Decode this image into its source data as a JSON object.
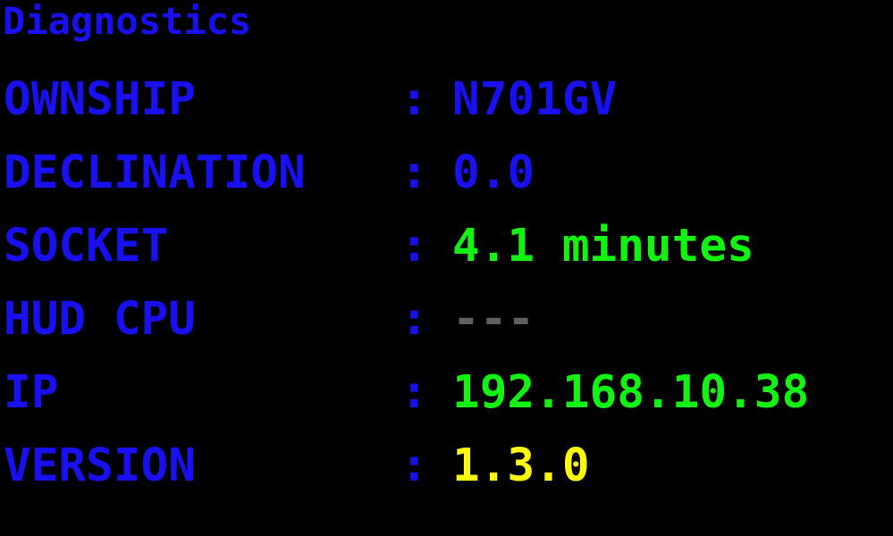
{
  "panel": {
    "title": "Diagnostics",
    "title_color": "#1810f0",
    "background_color": "#000000",
    "separator": ":"
  },
  "colors": {
    "label": "#1810f0",
    "value_blue": "#1810f0",
    "value_green": "#12f312",
    "value_yellow": "#fcf80a",
    "value_gray": "#5f5f5f"
  },
  "rows": [
    {
      "label": "OWNSHIP",
      "separator": ":",
      "value": "N701GV",
      "value_color": "#1810f0",
      "value_class": "v-blue"
    },
    {
      "label": "DECLINATION",
      "separator": ":",
      "value": "0.0",
      "value_color": "#1810f0",
      "value_class": "v-blue"
    },
    {
      "label": "SOCKET",
      "separator": ":",
      "value": "4.1 minutes",
      "value_color": "#12f312",
      "value_class": "v-green"
    },
    {
      "label": "HUD CPU",
      "separator": ":",
      "value": "---",
      "value_color": "#5f5f5f",
      "value_class": "v-gray"
    },
    {
      "label": "IP",
      "separator": ":",
      "value": "192.168.10.38",
      "value_color": "#12f312",
      "value_class": "v-green"
    },
    {
      "label": "VERSION",
      "separator": ":",
      "value": "1.3.0",
      "value_color": "#fcf80a",
      "value_class": "v-yellow"
    }
  ]
}
